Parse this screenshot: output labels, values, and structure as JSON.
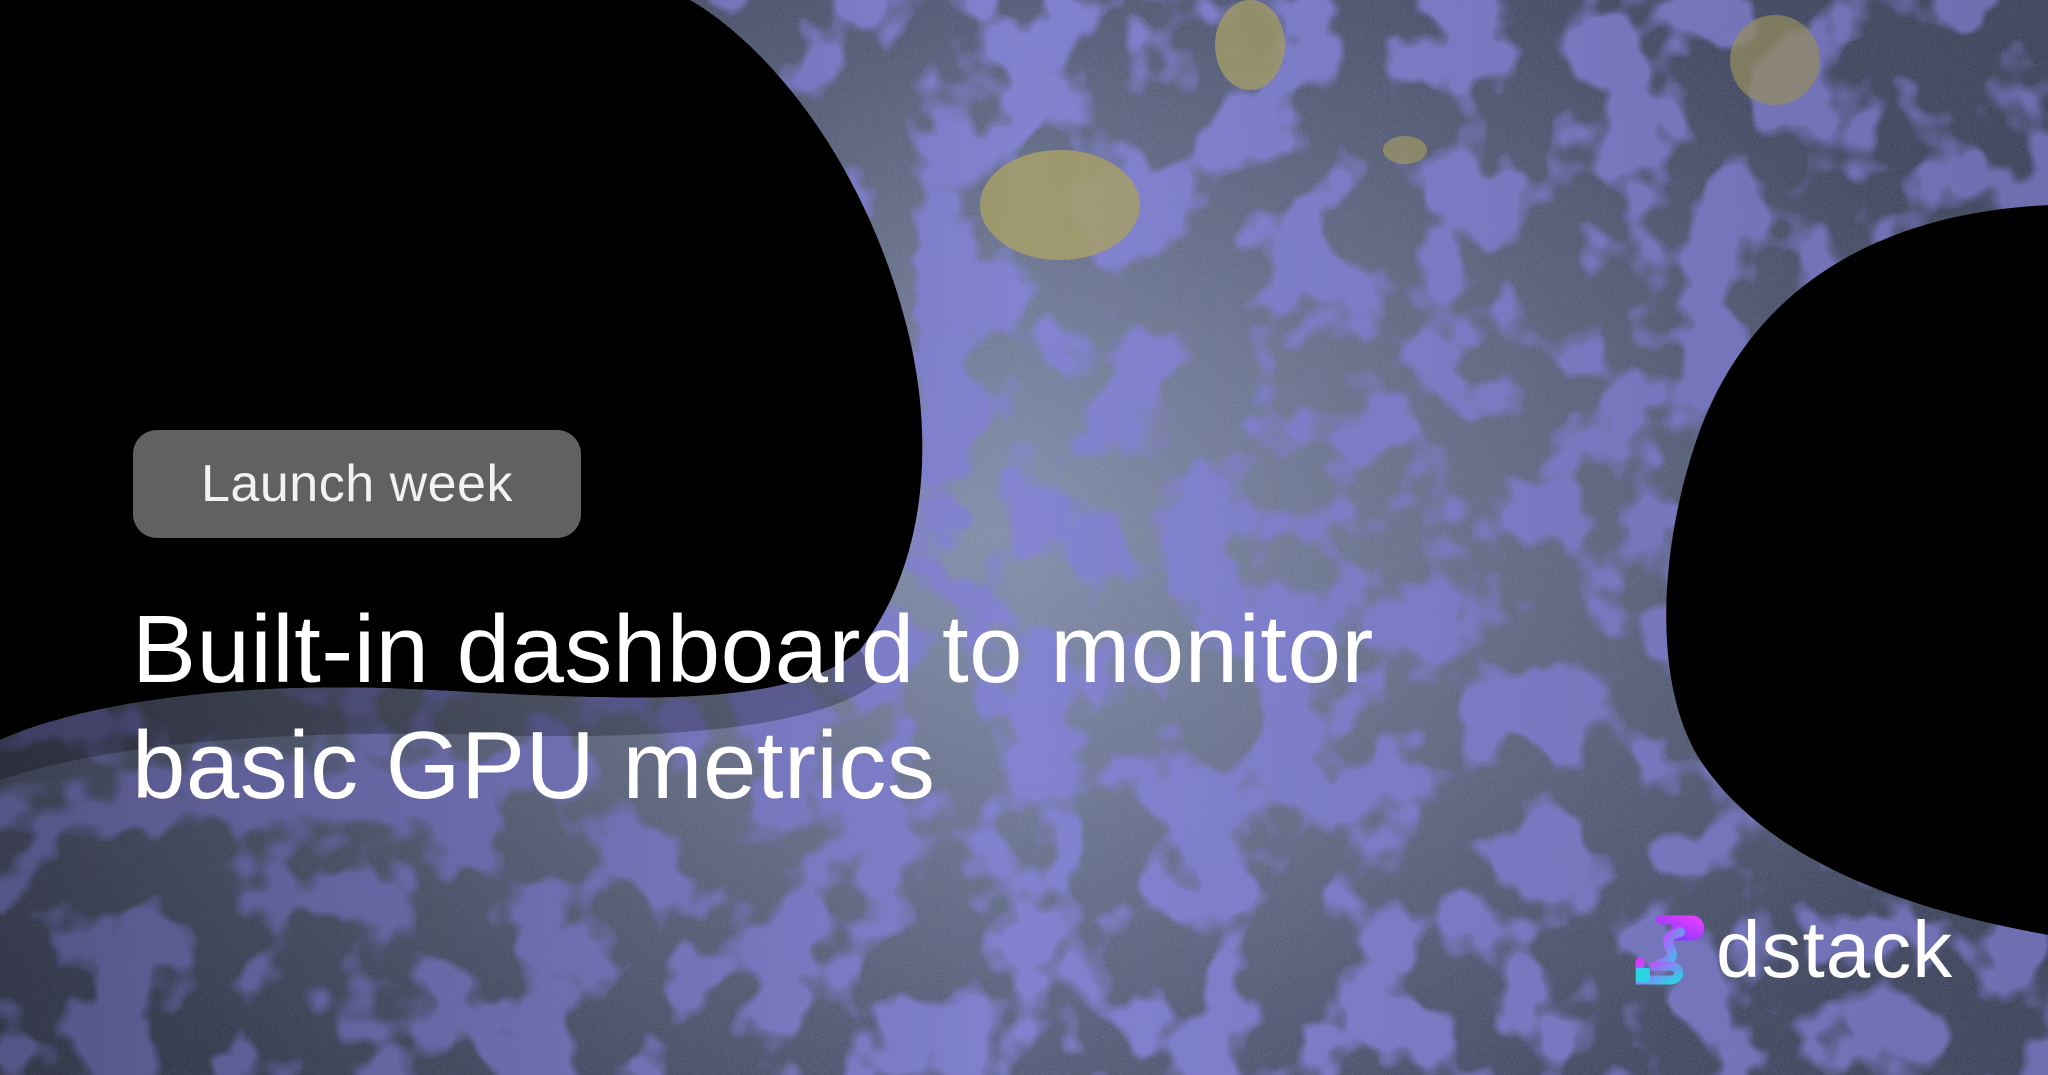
{
  "badge": {
    "label": "Launch week"
  },
  "headline": {
    "line1": "Built-in dashboard to monitor",
    "line2": "basic GPU metrics"
  },
  "brand": {
    "name": "dstack",
    "icon": "dstack-logo-icon",
    "gradient_start": "#d63bff",
    "gradient_end": "#2ad3e6"
  },
  "colors": {
    "background": "#000000",
    "surface_blue": "#3b3aa8",
    "surface_grey": "#7f8aa8",
    "surface_tan": "#a8a06a",
    "badge_fill": "#6e6e6e",
    "text": "#ffffff"
  }
}
